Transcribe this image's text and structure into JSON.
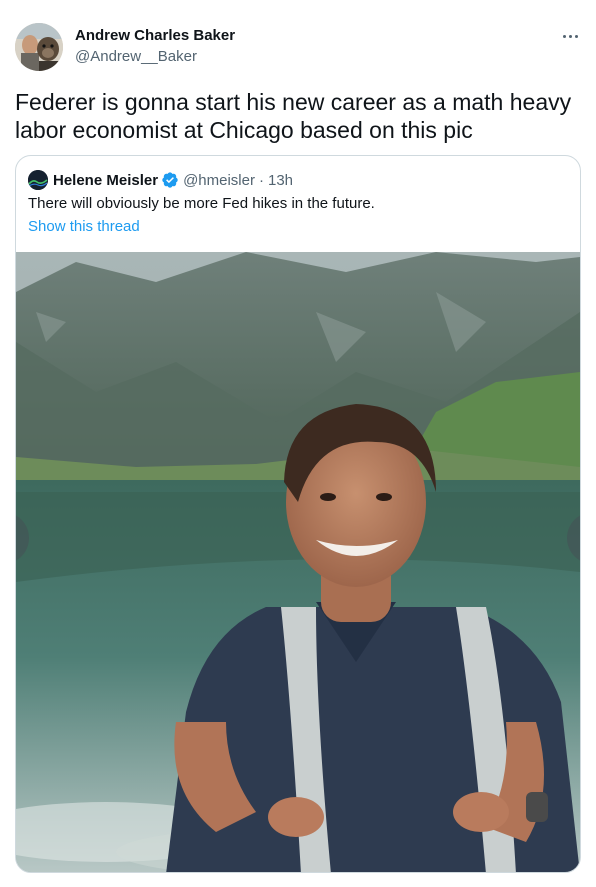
{
  "tweet": {
    "author_name": "Andrew Charles Baker",
    "author_handle": "@Andrew__Baker",
    "text": "Federer is gonna start his new career as a math heavy labor economist at Chicago based on this pic"
  },
  "quoted_tweet": {
    "author_name": "Helene Meisler",
    "author_handle": "@hmeisler",
    "separator": "·",
    "time": "13h",
    "text": "There will obviously be more Fed hikes in the future.",
    "show_thread": "Show this thread",
    "verified": true
  },
  "colors": {
    "text_primary": "#0f1419",
    "text_secondary": "#536471",
    "link": "#1d9bf0",
    "verified_badge": "#1d9bf0",
    "border": "#cfd9de"
  },
  "icons": [
    "more-options-icon",
    "verified-badge-icon"
  ]
}
